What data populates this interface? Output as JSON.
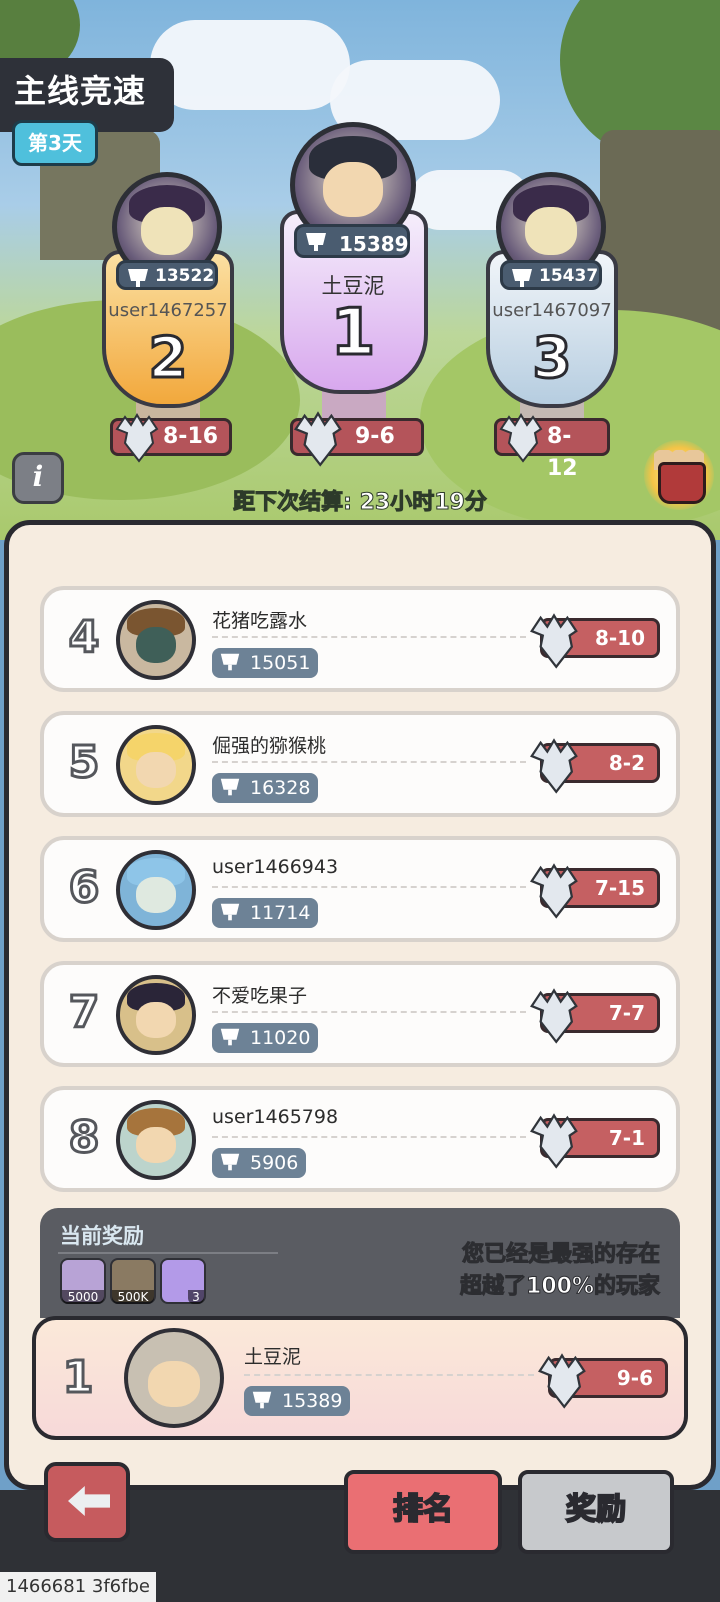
{
  "header": {
    "title": "主线竞速",
    "day_badge": "第3天"
  },
  "podium": [
    {
      "place": "2",
      "name": "user1467257",
      "score": "13522",
      "level": "8-16"
    },
    {
      "place": "1",
      "name": "土豆泥",
      "score": "15389",
      "level": "9-6"
    },
    {
      "place": "3",
      "name": "user1467097",
      "score": "15437",
      "level": "8-12"
    }
  ],
  "info_label": "i",
  "countdown": "距下次结算: 23小时19分",
  "rows": [
    {
      "rank": "4",
      "name": "花猪吃露水",
      "score": "15051",
      "level": "8-10"
    },
    {
      "rank": "5",
      "name": "倔强的猕猴桃",
      "score": "16328",
      "level": "8-2"
    },
    {
      "rank": "6",
      "name": "user1466943",
      "score": "11714",
      "level": "7-15"
    },
    {
      "rank": "7",
      "name": "不爱吃果子",
      "score": "11020",
      "level": "7-7"
    },
    {
      "rank": "8",
      "name": "user1465798",
      "score": "5906",
      "level": "7-1"
    }
  ],
  "reward": {
    "title": "当前奖励",
    "items": [
      {
        "icon": "potion-icon",
        "amount": "5000"
      },
      {
        "icon": "coin-icon",
        "amount": "500K"
      },
      {
        "icon": "speedup-24h-icon",
        "amount": "3"
      }
    ],
    "message_line1": "您已经是最强的存在",
    "message_line2": "超越了100%的玩家"
  },
  "self": {
    "rank": "1",
    "name": "土豆泥",
    "score": "15389",
    "level": "9-6"
  },
  "tabs": {
    "rank": "排名",
    "reward": "奖励"
  },
  "footer_id": "1466681 3f6fbe"
}
